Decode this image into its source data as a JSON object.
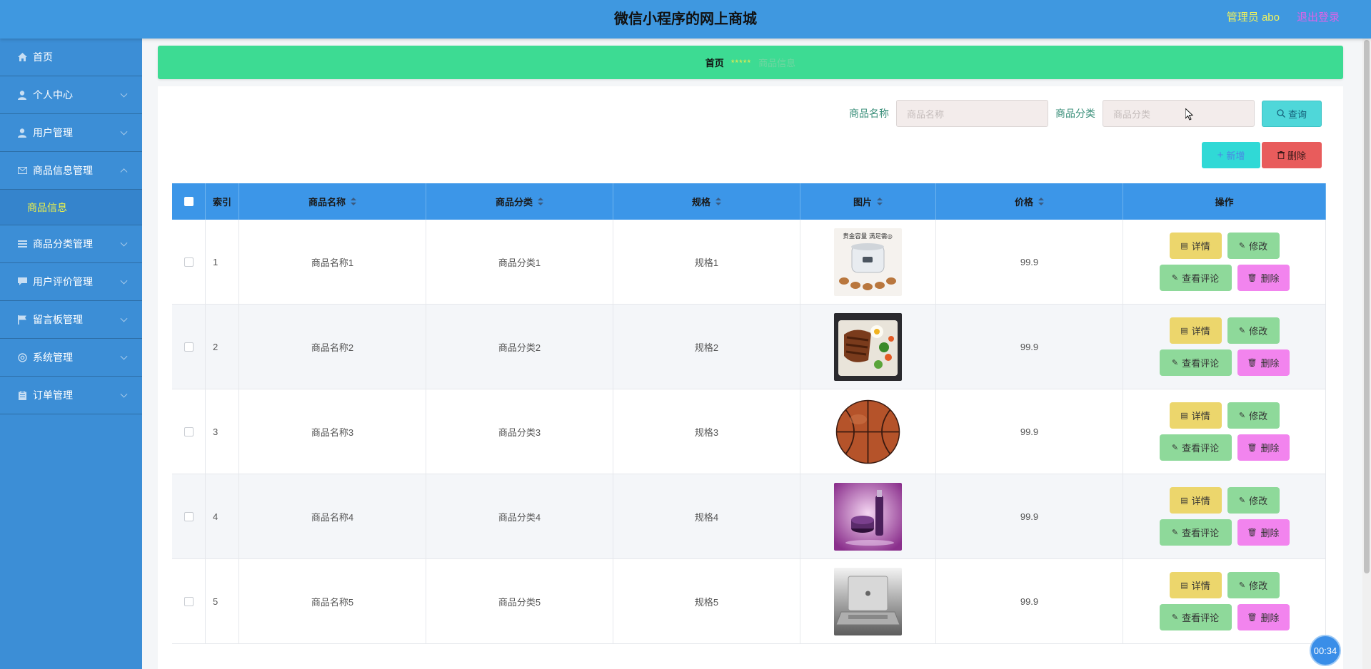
{
  "header": {
    "title": "微信小程序的网上商城",
    "admin": "管理员 abo",
    "logout": "退出登录"
  },
  "sidebar": {
    "items": [
      {
        "label": "首页",
        "icon": "home-icon",
        "expandable": false
      },
      {
        "label": "个人中心",
        "icon": "user-icon",
        "expandable": true
      },
      {
        "label": "用户管理",
        "icon": "user-icon",
        "expandable": true
      },
      {
        "label": "商品信息管理",
        "icon": "mail-icon",
        "expandable": true,
        "open": true
      },
      {
        "label": "商品分类管理",
        "icon": "list-icon",
        "expandable": true
      },
      {
        "label": "用户评价管理",
        "icon": "comment-icon",
        "expandable": true
      },
      {
        "label": "留言板管理",
        "icon": "flag-icon",
        "expandable": true
      },
      {
        "label": "系统管理",
        "icon": "at-icon",
        "expandable": true
      },
      {
        "label": "订单管理",
        "icon": "clipboard-icon",
        "expandable": true
      }
    ],
    "active_sub": "商品信息"
  },
  "breadcrumb": {
    "home": "首页",
    "separator": "*****",
    "current": "商品信息"
  },
  "search": {
    "name_label": "商品名称",
    "name_placeholder": "商品名称",
    "category_label": "商品分类",
    "category_placeholder": "商品分类",
    "query_label": "查询"
  },
  "actions": {
    "add_label": "新增",
    "delete_label": "删除"
  },
  "table": {
    "columns": [
      "索引",
      "商品名称",
      "商品分类",
      "规格",
      "图片",
      "价格",
      "操作"
    ],
    "rows": [
      {
        "index": "1",
        "name": "商品名称1",
        "category": "商品分类1",
        "spec": "规格1",
        "image": "rice-cooker-image",
        "price": "99.9"
      },
      {
        "index": "2",
        "name": "商品名称2",
        "category": "商品分类2",
        "spec": "规格2",
        "image": "bento-image",
        "price": "99.9"
      },
      {
        "index": "3",
        "name": "商品名称3",
        "category": "商品分类3",
        "spec": "规格3",
        "image": "basketball-image",
        "price": "99.9"
      },
      {
        "index": "4",
        "name": "商品名称4",
        "category": "商品分类4",
        "spec": "规格4",
        "image": "cosmetics-image",
        "price": "99.9"
      },
      {
        "index": "5",
        "name": "商品名称5",
        "category": "商品分类5",
        "spec": "规格5",
        "image": "laptop-image",
        "price": "99.9"
      }
    ],
    "ops": {
      "detail": "详情",
      "edit": "修改",
      "review": "查看评论",
      "delete": "删除"
    }
  },
  "overlay": {
    "header_banner_text": "贵金容量 满足需◎",
    "timer": "00:34"
  },
  "colors": {
    "header": "#3f98e0",
    "sidebar": "#3c8ed6",
    "breadcrumb": "#3ddb93",
    "table_header": "#3c96e8"
  }
}
